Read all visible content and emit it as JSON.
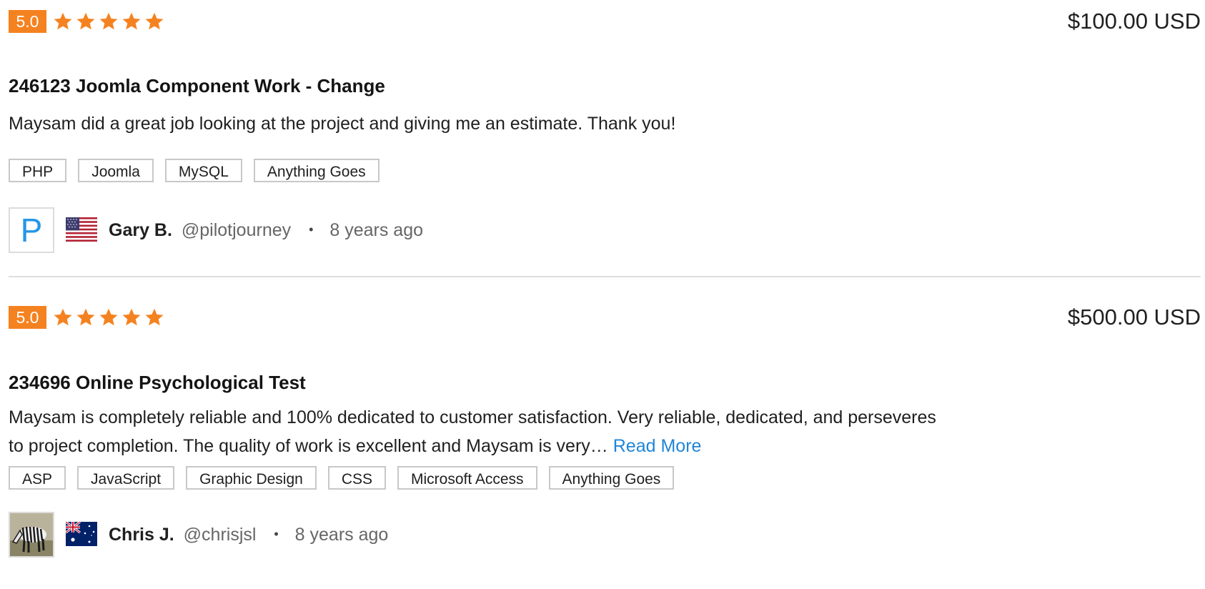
{
  "colors": {
    "badge": "#f58220",
    "star": "#f58220",
    "link": "#1f85d8",
    "avatar_letter": "#2697e6"
  },
  "reviews": [
    {
      "rating": "5.0",
      "stars": 5,
      "price": "$100.00 USD",
      "title": "246123 Joomla Component Work - Change",
      "description": "Maysam did a great job looking at the project and giving me an estimate. Thank you!",
      "read_more": "",
      "tags": [
        "PHP",
        "Joomla",
        "MySQL",
        "Anything Goes"
      ],
      "reviewer": {
        "avatar": "letter-avatar",
        "avatar_letter": "P",
        "flag": "us-flag-icon",
        "name": "Gary B.",
        "handle": "@pilotjourney",
        "separator": "•",
        "time": "8 years ago"
      }
    },
    {
      "rating": "5.0",
      "stars": 5,
      "price": "$500.00 USD",
      "title": "234696 Online Psychological Test",
      "description": "Maysam is completely reliable and 100% dedicated to customer satisfaction. Very reliable, dedicated, and perseveres to project completion. The quality of work is excellent and Maysam is very…",
      "read_more": "Read More",
      "tags": [
        "ASP",
        "JavaScript",
        "Graphic Design",
        "CSS",
        "Microsoft Access",
        "Anything Goes"
      ],
      "reviewer": {
        "avatar": "zebra-photo-avatar",
        "avatar_letter": "",
        "flag": "au-flag-icon",
        "name": "Chris J.",
        "handle": "@chrisjsl",
        "separator": "•",
        "time": "8 years ago"
      }
    }
  ]
}
